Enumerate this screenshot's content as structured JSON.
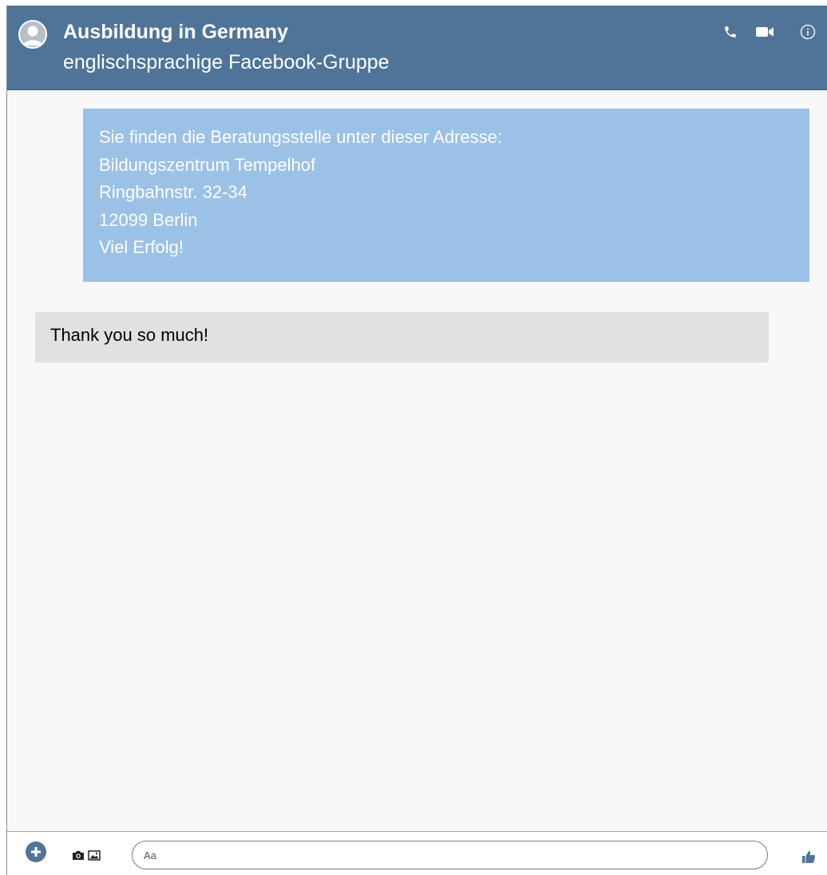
{
  "header": {
    "title": "Ausbildung in Germany",
    "subtitle": "englischsprachige Facebook-Gruppe",
    "icons": [
      "phone-icon",
      "video-camera-icon",
      "info-icon"
    ]
  },
  "messages": [
    {
      "direction": "outgoing",
      "lines": [
        "Sie finden die Beratungsstelle unter dieser Adresse:",
        "Bildungszentrum Tempelhof",
        "Ringbahnstr. 32-34",
        "12099 Berlin",
        "Viel Erfolg!"
      ]
    },
    {
      "direction": "incoming",
      "text": "Thank you so much!"
    }
  ],
  "composer": {
    "placeholder": "Aa",
    "icons": [
      "plus-icon",
      "camera-icon",
      "image-icon",
      "thumbs-up-icon"
    ]
  },
  "colors": {
    "header_bg": "#4f7498",
    "outgoing_bubble": "#9bc1e6",
    "incoming_bubble": "#e1e1e1",
    "chat_bg": "#f8f8f8"
  }
}
